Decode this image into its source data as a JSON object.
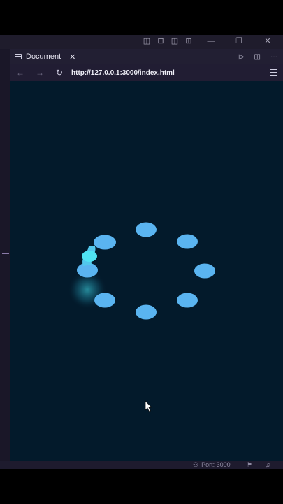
{
  "window": {
    "controls": [
      "layout-sidebar-icon",
      "layout-panel-icon",
      "layout-split-icon",
      "layout-customize-icon",
      "minimize-icon",
      "restore-icon",
      "close-icon"
    ]
  },
  "tab": {
    "title": "Document",
    "close_glyph": "✕"
  },
  "tab_actions": {
    "run_glyph": "▷",
    "split_glyph": "◫",
    "more_glyph": "···"
  },
  "nav": {
    "back_glyph": "←",
    "forward_glyph": "→",
    "reload_glyph": "↻",
    "url": "http://127.0.0.1:3000/index.html"
  },
  "status": {
    "port_label": "Port: 3000"
  },
  "colors": {
    "viewport_bg": "#031a2b",
    "dot": "#5ab4f0",
    "dot_glow": "#43e7f5"
  },
  "loader": {
    "dot_count": 8,
    "active_dot": "left"
  }
}
